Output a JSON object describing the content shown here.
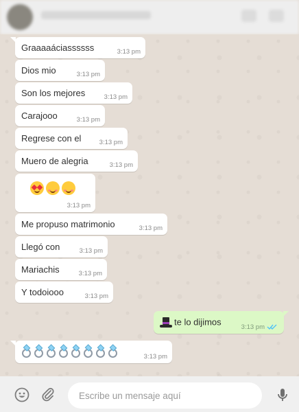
{
  "messages": [
    {
      "text": "Graaaaáciassssss",
      "time": "3:13 pm"
    },
    {
      "text": "Dios mio",
      "time": "3:13 pm"
    },
    {
      "text": "Son los mejores",
      "time": "3:13 pm"
    },
    {
      "text": "Carajooo",
      "time": "3:13 pm"
    },
    {
      "text": "Regrese con el",
      "time": "3:13 pm"
    },
    {
      "text": "Muero de alegria",
      "time": "3:13 pm"
    },
    {
      "emoji": [
        "heart-eyes-emoji",
        "smiling-face-with-hearts-emoji",
        "smiling-face-with-hearts-emoji"
      ],
      "time": "3:13 pm"
    },
    {
      "text": "Me propuso matrimonio",
      "time": "3:13 pm"
    },
    {
      "text": "Llegó con",
      "time": "3:13 pm"
    },
    {
      "text": "Mariachis",
      "time": "3:13 pm"
    },
    {
      "text": "Y todoiooo",
      "time": "3:13 pm"
    },
    {
      "text": "te lo dijimos",
      "emoji": [
        "top-hat-emoji"
      ],
      "time": "3:13 pm",
      "outgoing": true,
      "status": "read-double-check"
    },
    {
      "emoji": [
        "ring-emoji",
        "ring-emoji",
        "ring-emoji",
        "ring-emoji",
        "ring-emoji",
        "ring-emoji",
        "ring-emoji",
        "ring-emoji"
      ],
      "time": "3:13 pm"
    }
  ],
  "composer": {
    "placeholder": "Escribe un mensaje aquí",
    "icons": [
      "emoji-icon",
      "attach-icon",
      "microphone-icon"
    ]
  },
  "colors": {
    "chat_bg": "#e5ddd5",
    "incoming": "#ffffff",
    "outgoing": "#dcf8c6",
    "read_ticks": "#4fc3f7"
  }
}
